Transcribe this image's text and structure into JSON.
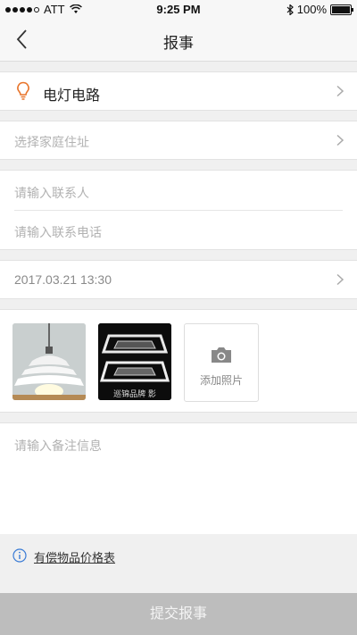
{
  "status_bar": {
    "carrier": "ATT",
    "time": "9:25 PM",
    "battery": "100%"
  },
  "header": {
    "title": "报事"
  },
  "category": {
    "label": "电灯电路",
    "icon": "lightbulb-icon",
    "icon_color": "#e8742a"
  },
  "address": {
    "placeholder": "选择家庭住址"
  },
  "contact": {
    "name_placeholder": "请输入联系人",
    "phone_placeholder": "请输入联系电话"
  },
  "datetime": {
    "value": "2017.03.21 13:30"
  },
  "photos": {
    "add_label": "添加照片",
    "thumb2_caption": "巡锦品牌 影"
  },
  "notes": {
    "placeholder": "请输入备注信息"
  },
  "pricing": {
    "link_text": "有偿物品价格表",
    "icon_color": "#3a7bd5"
  },
  "submit": {
    "label": "提交报事",
    "background": "#bdbdbd"
  }
}
